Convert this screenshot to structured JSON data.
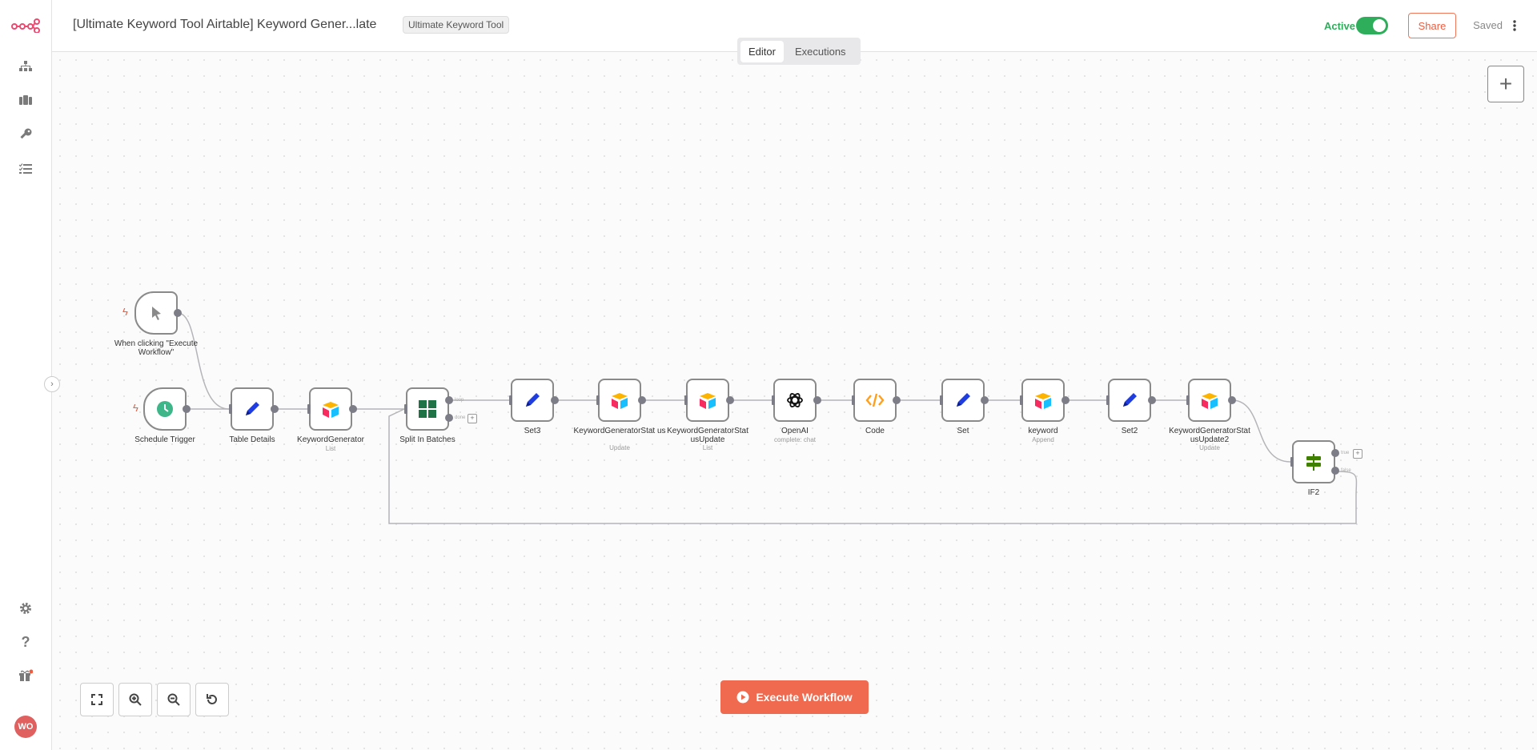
{
  "header": {
    "workflow_name": "[Ultimate Keyword Tool Airtable] Keyword Gener...late",
    "tag": "Ultimate Keyword Tool",
    "active_label": "Active",
    "share_label": "Share",
    "saved_label": "Saved"
  },
  "tabs": [
    {
      "label": "Editor",
      "selected": true
    },
    {
      "label": "Executions",
      "selected": false
    }
  ],
  "sidebar": {
    "items": [
      {
        "icon": "workflows-icon"
      },
      {
        "icon": "templates-icon"
      },
      {
        "icon": "credentials-icon"
      },
      {
        "icon": "executions-icon"
      }
    ],
    "bottom": [
      {
        "icon": "gear-icon"
      },
      {
        "icon": "help-icon"
      },
      {
        "icon": "gift-icon"
      }
    ],
    "avatar": "WO"
  },
  "nodes": {
    "manual": {
      "label": "When clicking \"Execute Workflow\""
    },
    "schedule": {
      "label": "Schedule Trigger"
    },
    "table_details": {
      "label": "Table Details"
    },
    "keyword_generator": {
      "label": "KeywordGenerator",
      "sub": "List"
    },
    "split_in_batches": {
      "label": "Split In Batches",
      "out_loop": "loop",
      "out_done": "done"
    },
    "set3": {
      "label": "Set3"
    },
    "status": {
      "label": "KeywordGeneratorStat us",
      "sub": "Update"
    },
    "status_update": {
      "label": "KeywordGeneratorStat usUpdate",
      "sub": "List"
    },
    "openai": {
      "label": "OpenAI",
      "sub": "complete: chat"
    },
    "code": {
      "label": "Code"
    },
    "set": {
      "label": "Set"
    },
    "keyword": {
      "label": "keyword",
      "sub": "Append"
    },
    "set2": {
      "label": "Set2"
    },
    "status_update2": {
      "label": "KeywordGeneratorStat usUpdate2",
      "sub": "Update"
    },
    "if2": {
      "label": "IF2",
      "out_true": "true",
      "out_false": "false"
    }
  },
  "execute_button": "Execute Workflow",
  "colors": {
    "accent": "#ef6a4f",
    "active": "#2eae5b"
  }
}
